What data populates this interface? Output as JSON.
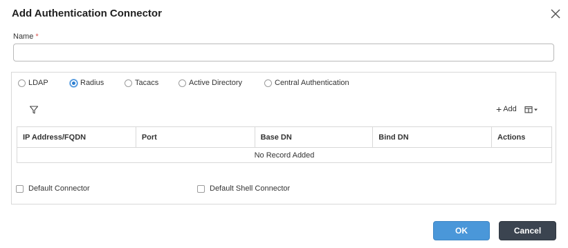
{
  "dialog": {
    "title": "Add Authentication Connector",
    "close_icon": "close-icon"
  },
  "name_field": {
    "label": "Name",
    "required_marker": "*",
    "value": "",
    "placeholder": ""
  },
  "connector_types": {
    "options": [
      {
        "label": "LDAP",
        "checked": false
      },
      {
        "label": "Radius",
        "checked": true
      },
      {
        "label": "Tacacs",
        "checked": false
      },
      {
        "label": "Active Directory",
        "checked": false
      },
      {
        "label": "Central Authentication",
        "checked": false
      }
    ]
  },
  "toolbar": {
    "filter_icon": "filter-icon",
    "add_label": "Add",
    "columns_icon": "columns-icon"
  },
  "table": {
    "headers": [
      "IP Address/FQDN",
      "Port",
      "Base DN",
      "Bind DN",
      "Actions"
    ],
    "empty_message": "No Record Added"
  },
  "options": {
    "default_connector": "Default Connector",
    "default_shell_connector": "Default Shell Connector"
  },
  "buttons": {
    "ok": "OK",
    "cancel": "Cancel"
  },
  "colors": {
    "primary": "#4a97d9",
    "secondary": "#3b4450",
    "required": "#d9534f"
  }
}
